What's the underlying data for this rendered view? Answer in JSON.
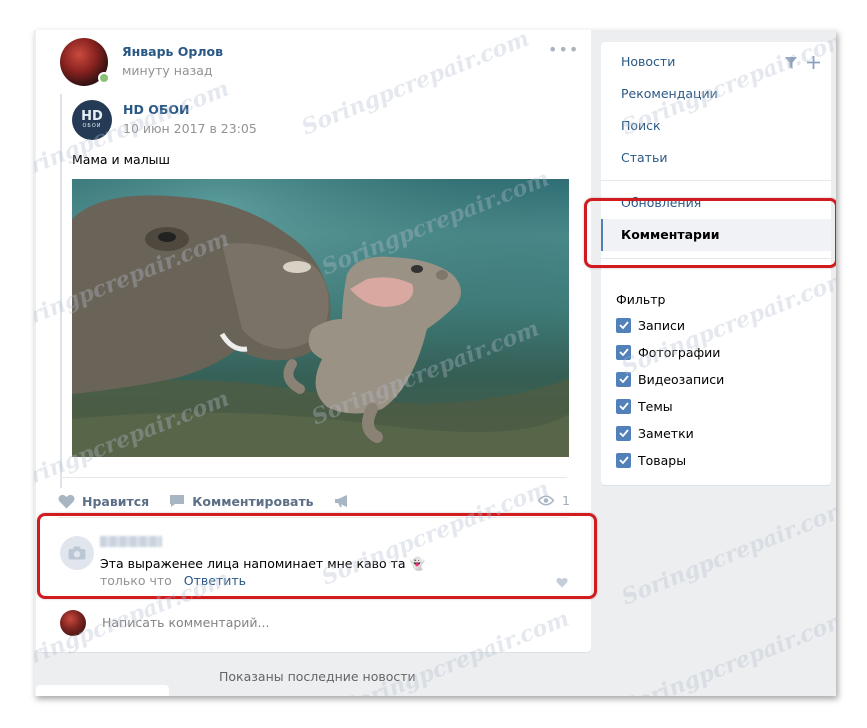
{
  "post": {
    "author": "Январь Орлов",
    "time": "минуту назад",
    "repost": {
      "avatar_text": "HD",
      "avatar_subtext": "ОБОИ",
      "name": "HD ОБОИ",
      "time": "10 июн 2017 в 23:05"
    },
    "text": "Мама и малыш",
    "actions": {
      "like": "Нравится",
      "comment": "Комментировать",
      "views": "1"
    },
    "comment": {
      "text": "Эта выраженее лица напоминает мне каво та 👻",
      "time": "только что",
      "reply": "Ответить"
    },
    "write_placeholder": "Написать комментарий..."
  },
  "menu": {
    "items": [
      "Новости",
      "Рекомендации",
      "Поиск",
      "Статьи"
    ],
    "secondary": [
      "Обновления",
      "Комментарии"
    ],
    "active": "Комментарии",
    "filter_title": "Фильтр",
    "filters": [
      "Записи",
      "Фотографии",
      "Видеозаписи",
      "Темы",
      "Заметки",
      "Товары"
    ]
  },
  "footer": {
    "shown": "Показаны последние новости"
  },
  "watermark": "Soringpcrepair.com",
  "colors": {
    "link": "#2a5885",
    "accent": "#5181b8",
    "highlight": "#d21b1f"
  }
}
